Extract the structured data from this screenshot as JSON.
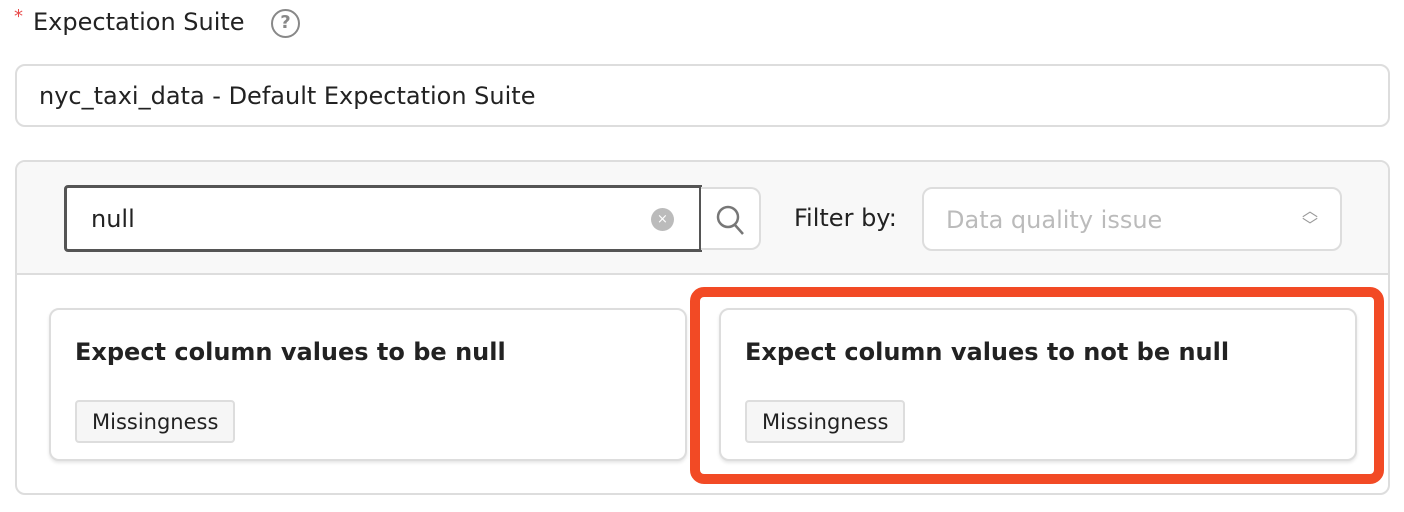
{
  "field": {
    "required_mark": "*",
    "label": "Expectation Suite",
    "help_icon": "question-circle-icon",
    "value": "nyc_taxi_data - Default Expectation Suite"
  },
  "search": {
    "value": "null",
    "clear_icon": "×"
  },
  "filter": {
    "label": "Filter by:",
    "placeholder": "Data quality issue"
  },
  "cards": [
    {
      "title": "Expect column values to be null",
      "tag": "Missingness"
    },
    {
      "title": "Expect column values to not be null",
      "tag": "Missingness",
      "highlighted": true
    }
  ],
  "colors": {
    "highlight": "#f24a25",
    "required": "#e84a4a"
  }
}
